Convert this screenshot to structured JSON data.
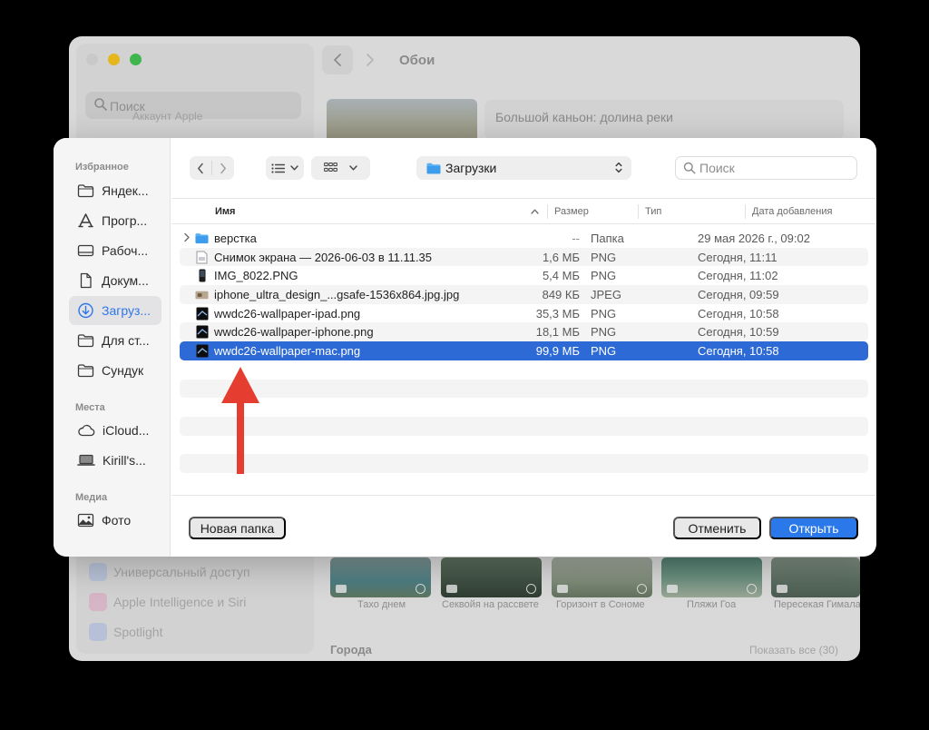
{
  "background_window": {
    "search_placeholder": "Поиск",
    "account_label": "Аккаунт Apple",
    "title": "Обои",
    "hero_label": "Большой каньон: долина реки",
    "sidebar_items": [
      {
        "label": "Универсальный доступ",
        "icon": "accessibility-icon",
        "color": "#b9c3d8"
      },
      {
        "label": "Apple Intelligence и Siri",
        "icon": "siri-icon",
        "color": "#d6b6c6"
      },
      {
        "label": "Spotlight",
        "icon": "spotlight-icon",
        "color": "#b7c0d6"
      }
    ],
    "thumbnails": [
      {
        "label": "Тахо днем"
      },
      {
        "label": "Секвойя на рассвете"
      },
      {
        "label": "Горизонт в Сономе"
      },
      {
        "label": "Пляжи Гоа"
      },
      {
        "label": "Пересекая Гимала"
      }
    ],
    "section_title": "Города",
    "show_all": "Показать все (30)"
  },
  "dialog": {
    "sidebar": {
      "sections": [
        {
          "title": "Избранное",
          "items": [
            {
              "label": "Яндек...",
              "icon": "folder-icon",
              "active": false
            },
            {
              "label": "Прогр...",
              "icon": "applications-icon",
              "active": false
            },
            {
              "label": "Рабоч...",
              "icon": "desktop-icon",
              "active": false
            },
            {
              "label": "Докум...",
              "icon": "document-icon",
              "active": false
            },
            {
              "label": "Загруз...",
              "icon": "downloads-icon",
              "active": true
            },
            {
              "label": "Для ст...",
              "icon": "folder-icon",
              "active": false
            },
            {
              "label": "Сундук",
              "icon": "folder-icon",
              "active": false
            }
          ]
        },
        {
          "title": "Места",
          "items": [
            {
              "label": "iCloud...",
              "icon": "icloud-icon",
              "active": false
            },
            {
              "label": "Kirill's...",
              "icon": "laptop-icon",
              "active": false
            }
          ]
        },
        {
          "title": "Медиа",
          "items": [
            {
              "label": "Фото",
              "icon": "photos-icon",
              "active": false
            }
          ]
        }
      ]
    },
    "toolbar": {
      "current_folder": "Загрузки",
      "search_placeholder": "Поиск"
    },
    "columns": {
      "name": "Имя",
      "size": "Размер",
      "type": "Тип",
      "date": "Дата добавления"
    },
    "files": [
      {
        "name": "верстка",
        "size": "--",
        "type": "Папка",
        "date": "29 мая 2026 г., 09:02",
        "icon": "folder-icon",
        "folder": true,
        "selected": false
      },
      {
        "name": "Снимок экрана — 2026-06-03 в 11.11.35",
        "size": "1,6 МБ",
        "type": "PNG",
        "date": "Сегодня, 11:11",
        "icon": "screenshot-file-icon",
        "folder": false,
        "selected": false
      },
      {
        "name": "IMG_8022.PNG",
        "size": "5,4 МБ",
        "type": "PNG",
        "date": "Сегодня, 11:02",
        "icon": "image-file-icon",
        "folder": false,
        "selected": false
      },
      {
        "name": "iphone_ultra_design_...gsafe-1536x864.jpg.jpg",
        "size": "849 КБ",
        "type": "JPEG",
        "date": "Сегодня, 09:59",
        "icon": "image-file-icon",
        "folder": false,
        "selected": false
      },
      {
        "name": "wwdc26-wallpaper-ipad.png",
        "size": "35,3 МБ",
        "type": "PNG",
        "date": "Сегодня, 10:58",
        "icon": "image-file-icon",
        "folder": false,
        "selected": false
      },
      {
        "name": "wwdc26-wallpaper-iphone.png",
        "size": "18,1 МБ",
        "type": "PNG",
        "date": "Сегодня, 10:59",
        "icon": "image-file-icon",
        "folder": false,
        "selected": false
      },
      {
        "name": "wwdc26-wallpaper-mac.png",
        "size": "99,9 МБ",
        "type": "PNG",
        "date": "Сегодня, 10:58",
        "icon": "image-file-icon",
        "folder": false,
        "selected": true
      }
    ],
    "buttons": {
      "new_folder": "Новая папка",
      "cancel": "Отменить",
      "open": "Открыть"
    }
  },
  "colors": {
    "accent": "#2a78e9",
    "selection": "#2e6ad6",
    "annotation_arrow": "#e53d2f"
  }
}
